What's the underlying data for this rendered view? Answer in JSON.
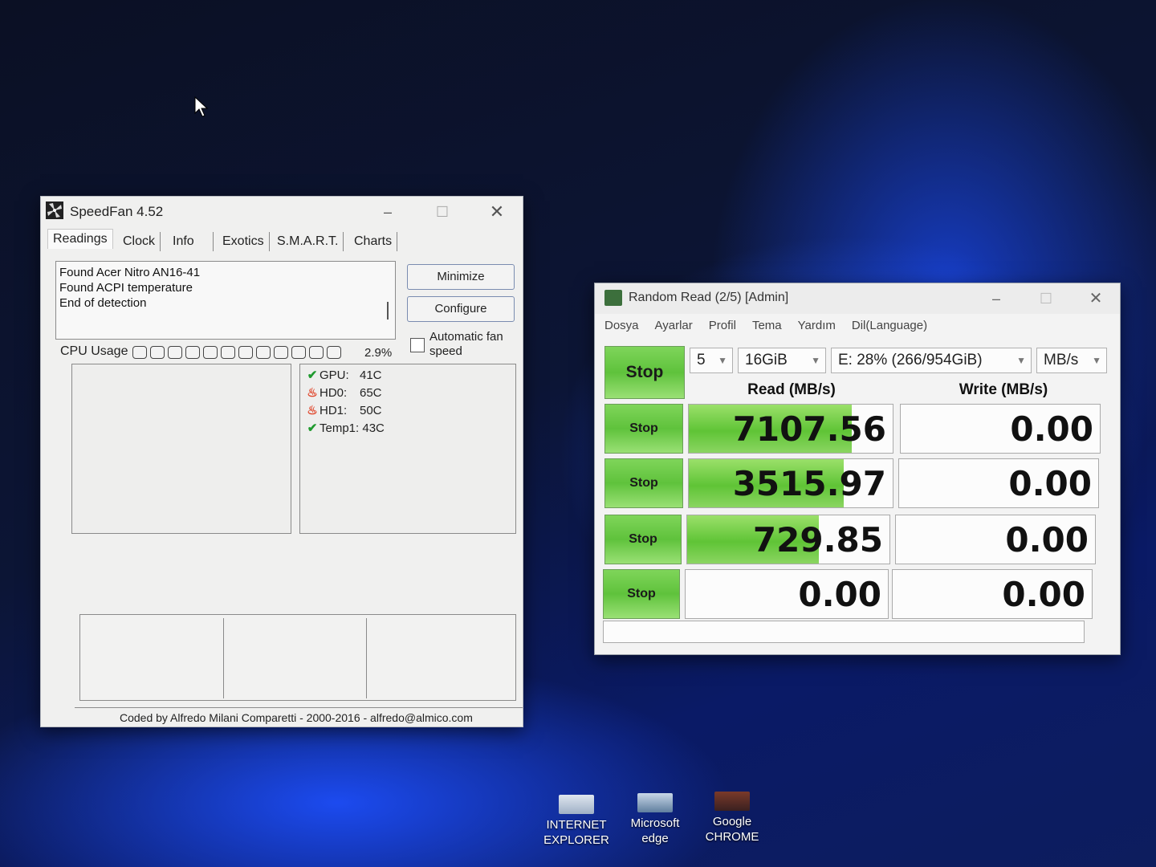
{
  "speedfan": {
    "title": "SpeedFan 4.52",
    "tabs": [
      "Readings",
      "Clock",
      "Info",
      "Exotics",
      "S.M.A.R.T.",
      "Charts"
    ],
    "active_tab": "Readings",
    "log_lines": [
      "Found Acer Nitro AN16-41",
      "Found ACPI temperature",
      "End of detection"
    ],
    "buttons": {
      "minimize": "Minimize",
      "configure": "Configure"
    },
    "auto_fan": {
      "label": "Automatic fan speed",
      "checked": false
    },
    "cpu_usage": {
      "label": "CPU Usage",
      "value": "2.9%",
      "fraction": 0.029
    },
    "readings": [
      {
        "status": "ok",
        "label": "GPU:",
        "value": "41C"
      },
      {
        "status": "hot",
        "label": "HD0:",
        "value": "65C"
      },
      {
        "status": "hot",
        "label": "HD1:",
        "value": "50C"
      },
      {
        "status": "ok",
        "label": "Temp1:",
        "value": "43C"
      }
    ],
    "footer": "Coded by Alfredo Milani Comparetti - 2000-2016 - alfredo@almico.com"
  },
  "cdm": {
    "title": "Random Read (2/5) [Admin]",
    "menu": [
      "Dosya",
      "Ayarlar",
      "Profil",
      "Tema",
      "Yardım",
      "Dil(Language)"
    ],
    "main_button": "Stop",
    "count": "5",
    "size": "16GiB",
    "drive": "E: 28% (266/954GiB)",
    "unit": "MB/s",
    "read_header": "Read (MB/s)",
    "write_header": "Write (MB/s)",
    "rows": [
      {
        "button": "Stop",
        "read": "7107.56",
        "read_fill": 0.8,
        "write": "0.00"
      },
      {
        "button": "Stop",
        "read": "3515.97",
        "read_fill": 0.76,
        "write": "0.00"
      },
      {
        "button": "Stop",
        "read": "729.85",
        "read_fill": 0.65,
        "write": "0.00"
      },
      {
        "button": "Stop",
        "read": "0.00",
        "read_fill": 0,
        "write": "0.00"
      }
    ]
  },
  "desktop_icons": [
    {
      "label_line1": "INTERNET",
      "label_line2": "EXPLORER"
    },
    {
      "label_line1": "Microsoft",
      "label_line2": "edge"
    },
    {
      "label_line1": "Google",
      "label_line2": "CHROME"
    }
  ]
}
